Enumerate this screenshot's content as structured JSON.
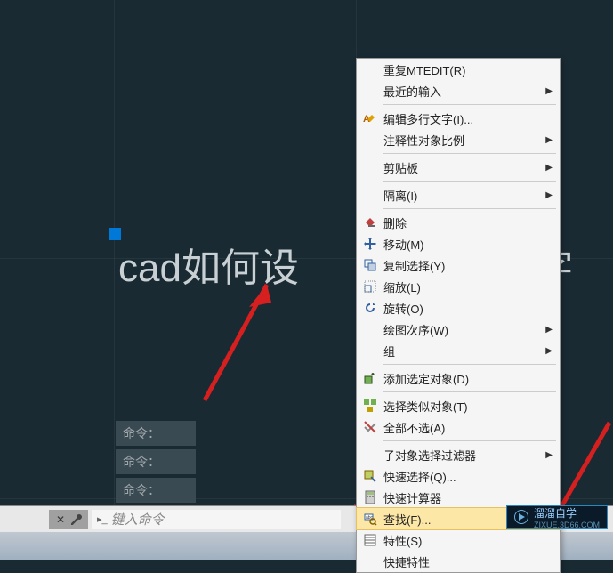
{
  "canvas": {
    "main_text_left": "cad如何设",
    "main_text_right": "字",
    "cmd_history": [
      "命令：",
      "命令：",
      "命令："
    ]
  },
  "cmd_bar": {
    "close_x": "✕",
    "wrench": "",
    "prompt": "▸_",
    "placeholder": "键入命令"
  },
  "menu": {
    "items": [
      {
        "label": "重复MTEDIT(R)",
        "icon": "",
        "arrow": false
      },
      {
        "label": "最近的输入",
        "icon": "",
        "arrow": true
      },
      {
        "sep": true
      },
      {
        "label": "编辑多行文字(I)...",
        "icon": "mtext-edit",
        "arrow": false
      },
      {
        "label": "注释性对象比例",
        "icon": "",
        "arrow": true
      },
      {
        "sep": true
      },
      {
        "label": "剪贴板",
        "icon": "",
        "arrow": true
      },
      {
        "sep": true
      },
      {
        "label": "隔离(I)",
        "icon": "",
        "arrow": true
      },
      {
        "sep": true
      },
      {
        "label": "删除",
        "icon": "erase",
        "arrow": false
      },
      {
        "label": "移动(M)",
        "icon": "move",
        "arrow": false
      },
      {
        "label": "复制选择(Y)",
        "icon": "copy",
        "arrow": false
      },
      {
        "label": "缩放(L)",
        "icon": "scale",
        "arrow": false
      },
      {
        "label": "旋转(O)",
        "icon": "rotate",
        "arrow": false
      },
      {
        "label": "绘图次序(W)",
        "icon": "",
        "arrow": true
      },
      {
        "label": "组",
        "icon": "",
        "arrow": true
      },
      {
        "sep": true
      },
      {
        "label": "添加选定对象(D)",
        "icon": "add-selected",
        "arrow": false
      },
      {
        "sep": true
      },
      {
        "label": "选择类似对象(T)",
        "icon": "select-similar",
        "arrow": false
      },
      {
        "label": "全部不选(A)",
        "icon": "deselect",
        "arrow": false
      },
      {
        "sep": true
      },
      {
        "label": "子对象选择过滤器",
        "icon": "",
        "arrow": true
      },
      {
        "label": "快速选择(Q)...",
        "icon": "quick-select",
        "arrow": false
      },
      {
        "label": "快速计算器",
        "icon": "calculator",
        "arrow": false
      },
      {
        "label": "查找(F)...",
        "icon": "find",
        "arrow": false,
        "highlighted": true
      },
      {
        "label": "特性(S)",
        "icon": "properties",
        "arrow": false
      },
      {
        "label": "快捷特性",
        "icon": "",
        "arrow": false
      }
    ]
  },
  "watermark": {
    "text": "溜溜自学",
    "url": "ZIXUE.3D66.COM"
  }
}
